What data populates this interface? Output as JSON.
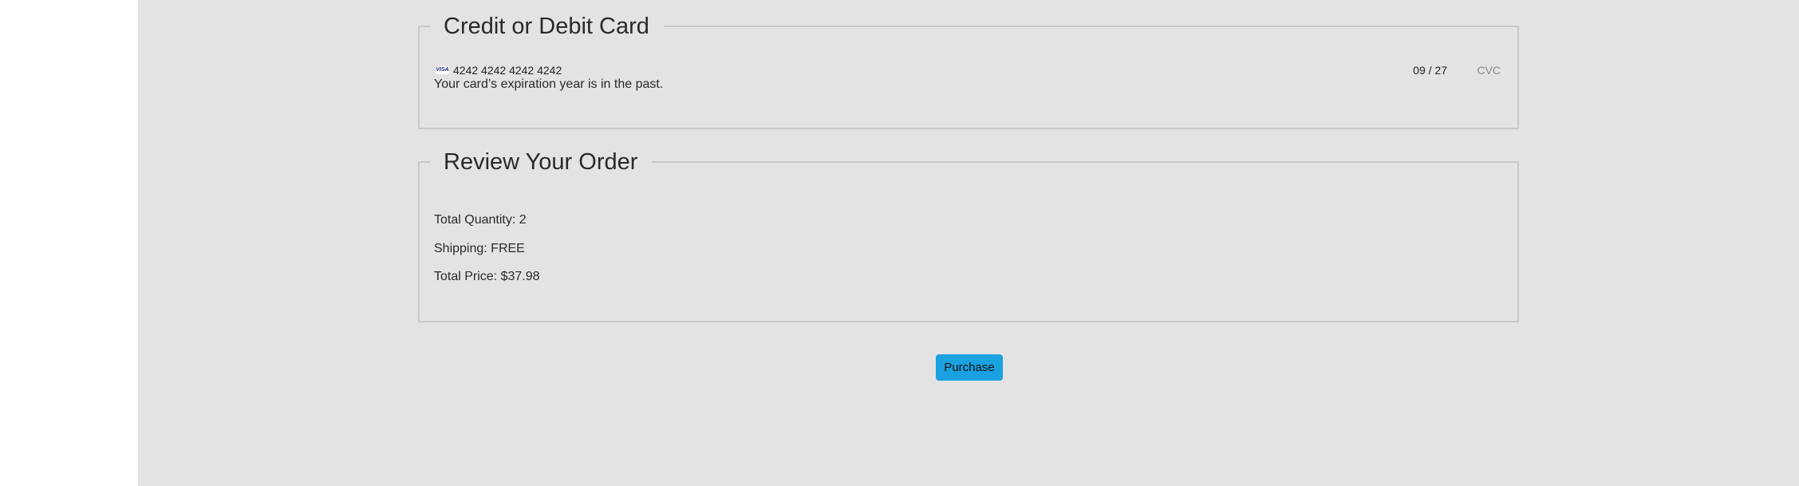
{
  "card_section": {
    "legend": "Credit or Debit Card",
    "card_brand_icon": "visa-icon",
    "card_brand_text": "VISA",
    "card_number": "4242 4242 4242 4242",
    "expiry": "09 / 27",
    "cvc_placeholder": "CVC",
    "error_message": "Your card’s expiration year is in the past."
  },
  "order_section": {
    "legend": "Review Your Order",
    "total_quantity": "Total Quantity: 2",
    "shipping": "Shipping: FREE",
    "total_price": "Total Price: $37.98"
  },
  "purchase_button": {
    "label": "Purchase",
    "color": "#1aa1e0"
  },
  "colors": {
    "background": "#e3e3e3",
    "border": "#c8c8c8"
  }
}
